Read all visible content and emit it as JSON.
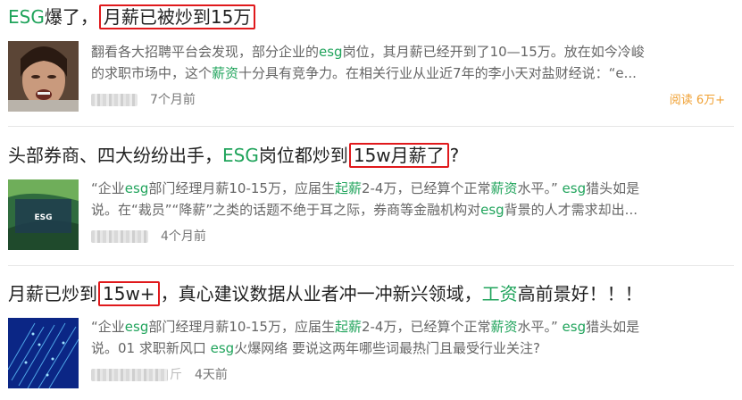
{
  "articles": [
    {
      "title_parts": {
        "a_hl": "ESG",
        "b": "爆了，",
        "c_box": "月薪已被炒到15万"
      },
      "snippet": {
        "l1_a": "翻看各大招聘平台会发现，部分企业的",
        "l1_b_hl": "esg",
        "l1_c": "岗位，其月薪已经开到了10—15万。放在如今冷峻",
        "l2_a": "的求职市场中，这个",
        "l2_b_hl": "薪资",
        "l2_c": "十分具有竞争力。在相关行业从业近7年的李小天对盐财经说：“e..."
      },
      "time": "7个月前",
      "reads": "阅读 6万+"
    },
    {
      "title_parts": {
        "a": "头部券商、四大纷纷出手，",
        "b_hl": "ESG",
        "c": "岗位都炒到",
        "d_box": "15w月薪了",
        "e": "?"
      },
      "snippet": {
        "l1_a": "“企业",
        "l1_b_hl": "esg",
        "l1_c": "部门经理月薪10-15万，应届生",
        "l1_d_hl": "起薪",
        "l1_e": "2-4万，已经算个正常",
        "l1_f_hl": "薪资",
        "l1_g": "水平。” ",
        "l1_h_hl": "esg",
        "l1_i": "猎头如是",
        "l2_a": "说。在“裁员”“降薪”之类的话题不绝于耳之际，券商等金融机构对",
        "l2_b_hl": "esg",
        "l2_c": "背景的人才需求却出..."
      },
      "thumb_label": "ESG",
      "time": "4个月前"
    },
    {
      "title_parts": {
        "a": "月薪已炒到",
        "b_box": "15w+",
        "c": "，真心建议数据从业者冲一冲新兴领域，",
        "d_hl": "工资",
        "e": "高前景好！！！"
      },
      "snippet": {
        "l1_a": "“企业",
        "l1_b_hl": "esg",
        "l1_c": "部门经理月薪10-15万，应届生",
        "l1_d_hl": "起薪",
        "l1_e": "2-4万，已经算个正常",
        "l1_f_hl": "薪资",
        "l1_g": "水平。” ",
        "l1_h_hl": "esg",
        "l1_i": "猎头如是",
        "l2_a": "说。01 求职新风口 ",
        "l2_b_hl": "esg",
        "l2_c": "火爆网络 要说这两年哪些词最热门且最受行业关注?"
      },
      "author_tail": "斤",
      "time": "4天前"
    }
  ],
  "colors": {
    "highlight": "#21a45c",
    "box": "#e0191c",
    "reads": "#f0a032"
  }
}
